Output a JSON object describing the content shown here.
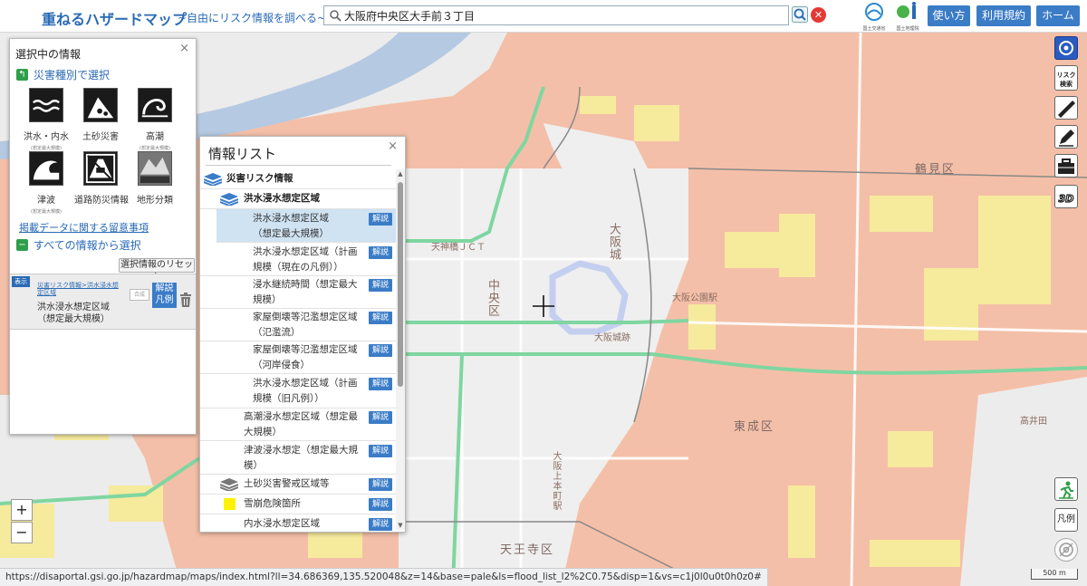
{
  "header": {
    "title": "重ねるハザードマップ",
    "subtitle": "~自由にリスク情報を調べる~",
    "search_value": "大阪府中央区大手前３丁目",
    "logos": [
      {
        "name": "mlit",
        "caption": "国土交通省"
      },
      {
        "name": "gsi",
        "caption": "国土地理院"
      }
    ],
    "buttons": {
      "usage": "使い方",
      "terms": "利用規約",
      "home": "ホーム"
    }
  },
  "selected_panel": {
    "title": "選択中の情報",
    "by_hazard_label": "災害種別で選択",
    "hazards": [
      {
        "label": "洪水・内水",
        "sub": "(想定最大規模)",
        "icon": "flood-icon"
      },
      {
        "label": "土砂災害",
        "sub": "",
        "icon": "landslide-icon"
      },
      {
        "label": "高潮",
        "sub": "(想定最大規模)",
        "icon": "storm-surge-icon"
      },
      {
        "label": "津波",
        "sub": "(想定最大規模)",
        "icon": "tsunami-icon"
      },
      {
        "label": "道路防災情報",
        "sub": "",
        "icon": "road-disaster-icon"
      },
      {
        "label": "地形分類",
        "sub": "",
        "icon": "terrain-icon"
      }
    ],
    "notes_link": "掲載データに関する留意事項",
    "all_info_label": "すべての情報から選択",
    "reset_label": "選択情報のリセット",
    "selected_item": {
      "show_badge": "表示",
      "path": "災害リスク情報>洪水浸水想定区域",
      "name_line1": "洪水浸水想定区域",
      "name_line2": "（想定最大規模）",
      "goukei": "合成",
      "kaisetsu": "解説",
      "hanrei": "凡例"
    }
  },
  "info_panel": {
    "title": "情報リスト",
    "kaisetsu": "解説",
    "items": [
      {
        "lines": [
          "災害リスク情報"
        ],
        "level": 0,
        "bold": true,
        "icon": "layers-icon-blue",
        "has_btn": false
      },
      {
        "lines": [
          "洪水浸水想定区域"
        ],
        "level": 1,
        "bold": true,
        "icon": "layers-icon-blue",
        "has_btn": false
      },
      {
        "lines": [
          "洪水浸水想定区域",
          "（想定最大規模）"
        ],
        "level": 2,
        "selected": true,
        "has_btn": true
      },
      {
        "lines": [
          "洪水浸水想定区域（計画",
          "規模（現在の凡例））"
        ],
        "level": 2,
        "has_btn": true
      },
      {
        "lines": [
          "浸水継続時間（想定最大",
          "規模）"
        ],
        "level": 2,
        "has_btn": true
      },
      {
        "lines": [
          "家屋倒壊等氾濫想定区域",
          "（氾濫流）"
        ],
        "level": 2,
        "has_btn": true
      },
      {
        "lines": [
          "家屋倒壊等氾濫想定区域",
          "（河岸侵食）"
        ],
        "level": 2,
        "has_btn": true
      },
      {
        "lines": [
          "洪水浸水想定区域（計画",
          "規模（旧凡例））"
        ],
        "level": 2,
        "has_btn": true
      },
      {
        "lines": [
          "高潮浸水想定区域（想定最",
          "大規模）"
        ],
        "level": 1,
        "has_btn": true
      },
      {
        "lines": [
          "津波浸水想定（想定最大規",
          "模）"
        ],
        "level": 1,
        "has_btn": true
      },
      {
        "lines": [
          "土砂災害警戒区域等"
        ],
        "level": 1,
        "icon": "layers-icon-gray",
        "has_btn": true
      },
      {
        "lines": [
          "雪崩危険箇所"
        ],
        "level": 1,
        "icon": "yellow-square-icon",
        "has_btn": true
      },
      {
        "lines": [
          "内水浸水想定区域"
        ],
        "level": 1,
        "has_btn": true
      }
    ]
  },
  "map": {
    "labels": [
      {
        "text": "中央区",
        "kind": "vert"
      },
      {
        "text": "鶴見区",
        "kind": "big"
      },
      {
        "text": "東成区",
        "kind": "big"
      },
      {
        "text": "天王寺区",
        "kind": "big"
      },
      {
        "text": "大阪城",
        "kind": "vert"
      },
      {
        "text": "大阪城跡",
        "kind": "small"
      },
      {
        "text": "天神橋ＪＣＴ",
        "kind": "small"
      },
      {
        "text": "大阪上本町駅",
        "kind": "vert"
      },
      {
        "text": "大阪公園駅",
        "kind": "small"
      },
      {
        "text": "高井田",
        "kind": "small"
      }
    ],
    "colors": {
      "flood_pink": "#f4bfa8",
      "flood_yellow": "#f6ea9d",
      "road_green": "#7fd6a0",
      "castle_water": "#d6dcf5"
    }
  },
  "tools": [
    {
      "name": "location-icon"
    },
    {
      "name": "risk-search-icon",
      "label": "リスク検索"
    },
    {
      "name": "ruler-icon"
    },
    {
      "name": "pencil-icon"
    },
    {
      "name": "toolbox-icon"
    },
    {
      "name": "3d-icon",
      "label": "3D"
    }
  ],
  "bottom_right": {
    "legend_label": "凡例",
    "scale": "500 m"
  },
  "zoom": {
    "in": "+",
    "out": "−"
  },
  "status_url": "https://disaportal.gsi.go.jp/hazardmap/maps/index.html?ll=34.686369,135.520048&z=14&base=pale&ls=flood_list_l2%2C0.75&disp=1&vs=c1j0l0u0t0h0z0#"
}
